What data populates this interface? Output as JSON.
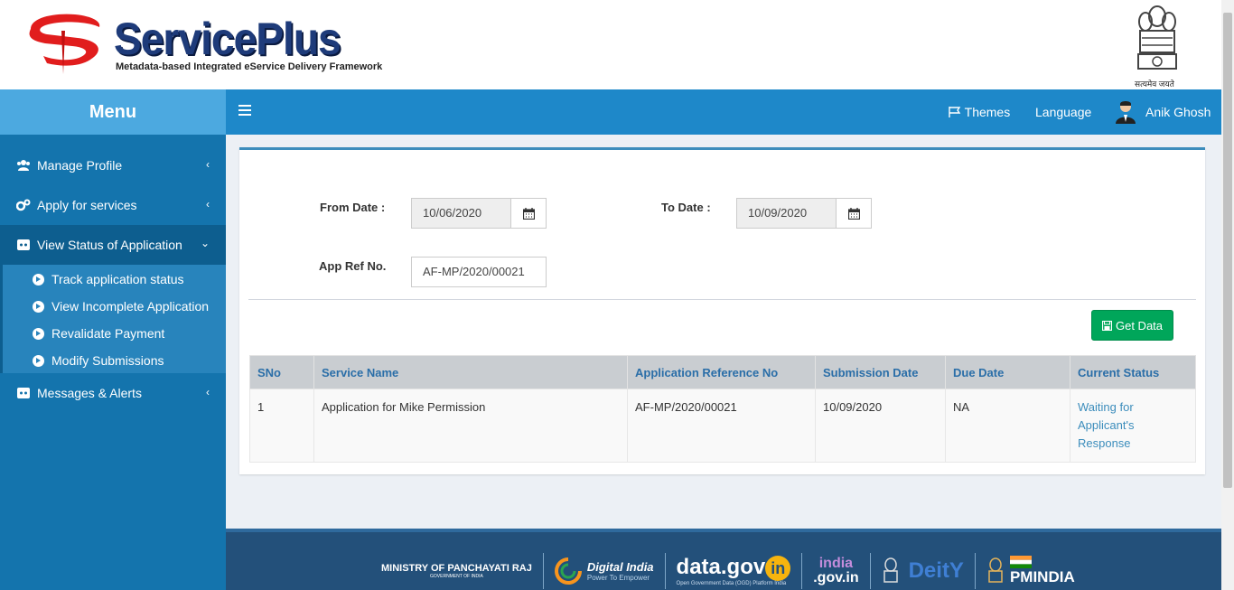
{
  "header": {
    "brand": "ServicePlus",
    "tagline": "Metadata-based Integrated eService Delivery Framework",
    "emblem_motto": "सत्यमेव जयते"
  },
  "sidebar": {
    "title": "Menu",
    "items": [
      {
        "label": "Manage Profile",
        "icon": "users-icon",
        "expanded": false
      },
      {
        "label": "Apply for services",
        "icon": "cogs-icon",
        "expanded": false
      },
      {
        "label": "View Status of Application",
        "icon": "status-icon",
        "expanded": true
      },
      {
        "label": "Messages & Alerts",
        "icon": "messages-icon",
        "expanded": false
      }
    ],
    "subitems": [
      {
        "label": "Track application status"
      },
      {
        "label": "View Incomplete Application"
      },
      {
        "label": "Revalidate Payment"
      },
      {
        "label": "Modify Submissions"
      }
    ]
  },
  "navbar": {
    "themes": "Themes",
    "language": "Language",
    "user": "Anik Ghosh"
  },
  "form": {
    "from_label": "From Date :",
    "from_value": "10/06/2020",
    "to_label": "To Date :",
    "to_value": "10/09/2020",
    "ref_label": "App Ref No.",
    "ref_value": "AF-MP/2020/00021",
    "get_button": "Get Data"
  },
  "table": {
    "headers": [
      "SNo",
      "Service Name",
      "Application Reference No",
      "Submission Date",
      "Due Date",
      "Current Status"
    ],
    "rows": [
      [
        "1",
        "Application for Mike Permission",
        "AF-MP/2020/00021",
        "10/09/2020",
        "NA",
        "Waiting for Applicant's Response"
      ]
    ]
  },
  "footer": {
    "ministry": "MINISTRY OF PANCHAYATI RAJ",
    "ministry_sub": "GOVERNMENT OF INDIA",
    "digital_india": "Digital India",
    "digital_india_sub": "Power To Empower",
    "datagov": "data.gov",
    "datagov_suffix": "in",
    "datagov_sub": "Open Government Data (OGD) Platform India",
    "indiagov_top": "india",
    "indiagov_bottom": ".gov.in",
    "deity": "DeitY",
    "pmindia": "PMINDIA"
  },
  "colors": {
    "sidebar": "#1474ad",
    "sidebar_head": "#4ca9e0",
    "navbar": "#1e88c9",
    "success": "#00a65a",
    "table_head_text": "#2a6ea8",
    "link": "#3c8dbc",
    "footer": "#23507a"
  }
}
